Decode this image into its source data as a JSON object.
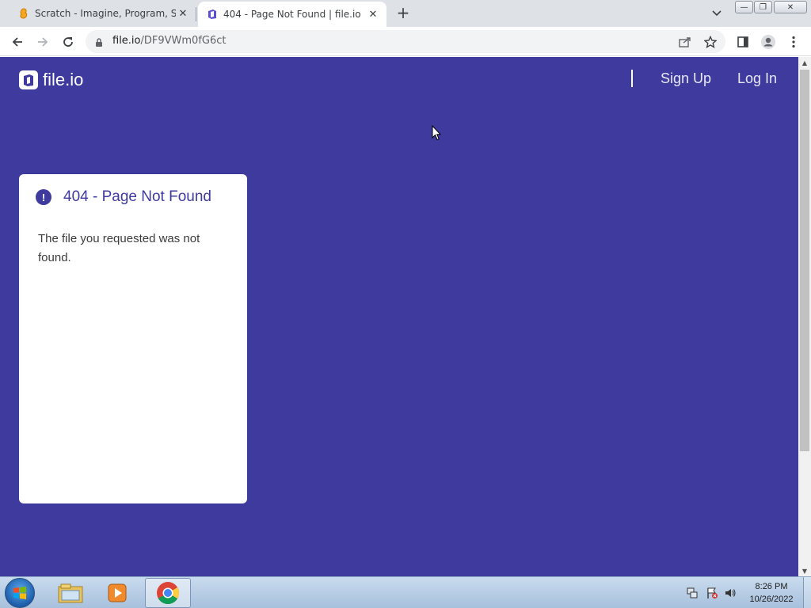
{
  "browser": {
    "tabs": [
      {
        "title": "Scratch - Imagine, Program, Shar",
        "icon": "scratch-favicon-icon",
        "active": false
      },
      {
        "title": "404 - Page Not Found | file.io",
        "icon": "fileio-favicon-icon",
        "active": true
      }
    ],
    "new_tab_symbol": "+",
    "close_symbol": "✕",
    "window_controls": {
      "minimize": "—",
      "maximize": "❐",
      "close": "✕"
    },
    "address": {
      "host": "file.io",
      "path": "/DF9VWm0fG6ct"
    }
  },
  "site": {
    "logo_text": "file.io",
    "nav": {
      "sign_up": "Sign Up",
      "log_in": "Log In"
    },
    "brand_color": "#3f3a9e"
  },
  "error_card": {
    "icon_glyph": "!",
    "title": "404 - Page Not Found",
    "message": "The file you requested was not found."
  },
  "taskbar": {
    "apps": [
      "windows-explorer-icon",
      "media-player-icon",
      "chrome-icon"
    ],
    "clock": {
      "time": "8:26 PM",
      "date": "10/26/2022"
    }
  }
}
